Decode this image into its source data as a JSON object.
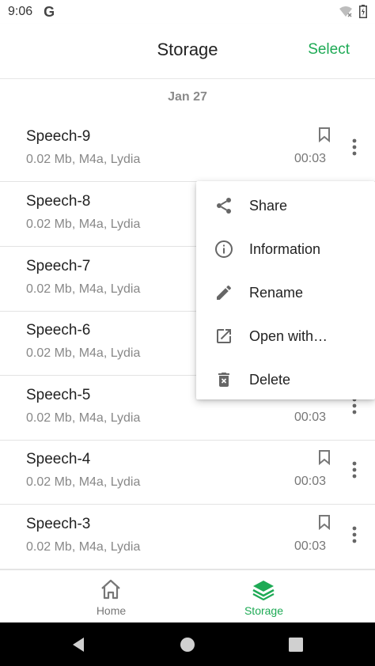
{
  "status_bar": {
    "time": "9:06",
    "g_logo": "G",
    "icons": [
      "wifi-icon",
      "battery-icon"
    ]
  },
  "app_bar": {
    "title": "Storage",
    "action_label": "Select"
  },
  "accent_color": "#1eaa55",
  "list": {
    "date_header": "Jan 27",
    "items": [
      {
        "name": "Speech-9",
        "meta": "0.02 Mb, M4a, Lydia",
        "duration": "00:03"
      },
      {
        "name": "Speech-8",
        "meta": "0.02 Mb, M4a, Lydia",
        "duration": ""
      },
      {
        "name": "Speech-7",
        "meta": "0.02 Mb, M4a, Lydia",
        "duration": ""
      },
      {
        "name": "Speech-6",
        "meta": "0.02 Mb, M4a, Lydia",
        "duration": ""
      },
      {
        "name": "Speech-5",
        "meta": "0.02 Mb, M4a, Lydia",
        "duration": "00:03"
      },
      {
        "name": "Speech-4",
        "meta": "0.02 Mb, M4a, Lydia",
        "duration": "00:03"
      },
      {
        "name": "Speech-3",
        "meta": "0.02 Mb, M4a, Lydia",
        "duration": "00:03"
      }
    ]
  },
  "context_menu": {
    "items": [
      {
        "label": "Share",
        "icon": "share-icon"
      },
      {
        "label": "Information",
        "icon": "info-icon"
      },
      {
        "label": "Rename",
        "icon": "pencil-icon"
      },
      {
        "label": "Open with…",
        "icon": "open-external-icon"
      },
      {
        "label": "Delete",
        "icon": "trash-icon"
      }
    ]
  },
  "bottom_nav": {
    "items": [
      {
        "label": "Home",
        "icon": "home-icon",
        "active": false
      },
      {
        "label": "Storage",
        "icon": "layers-icon",
        "active": true
      }
    ]
  },
  "system_nav": {
    "buttons": [
      "back-icon",
      "home-circle-icon",
      "recents-icon"
    ]
  }
}
